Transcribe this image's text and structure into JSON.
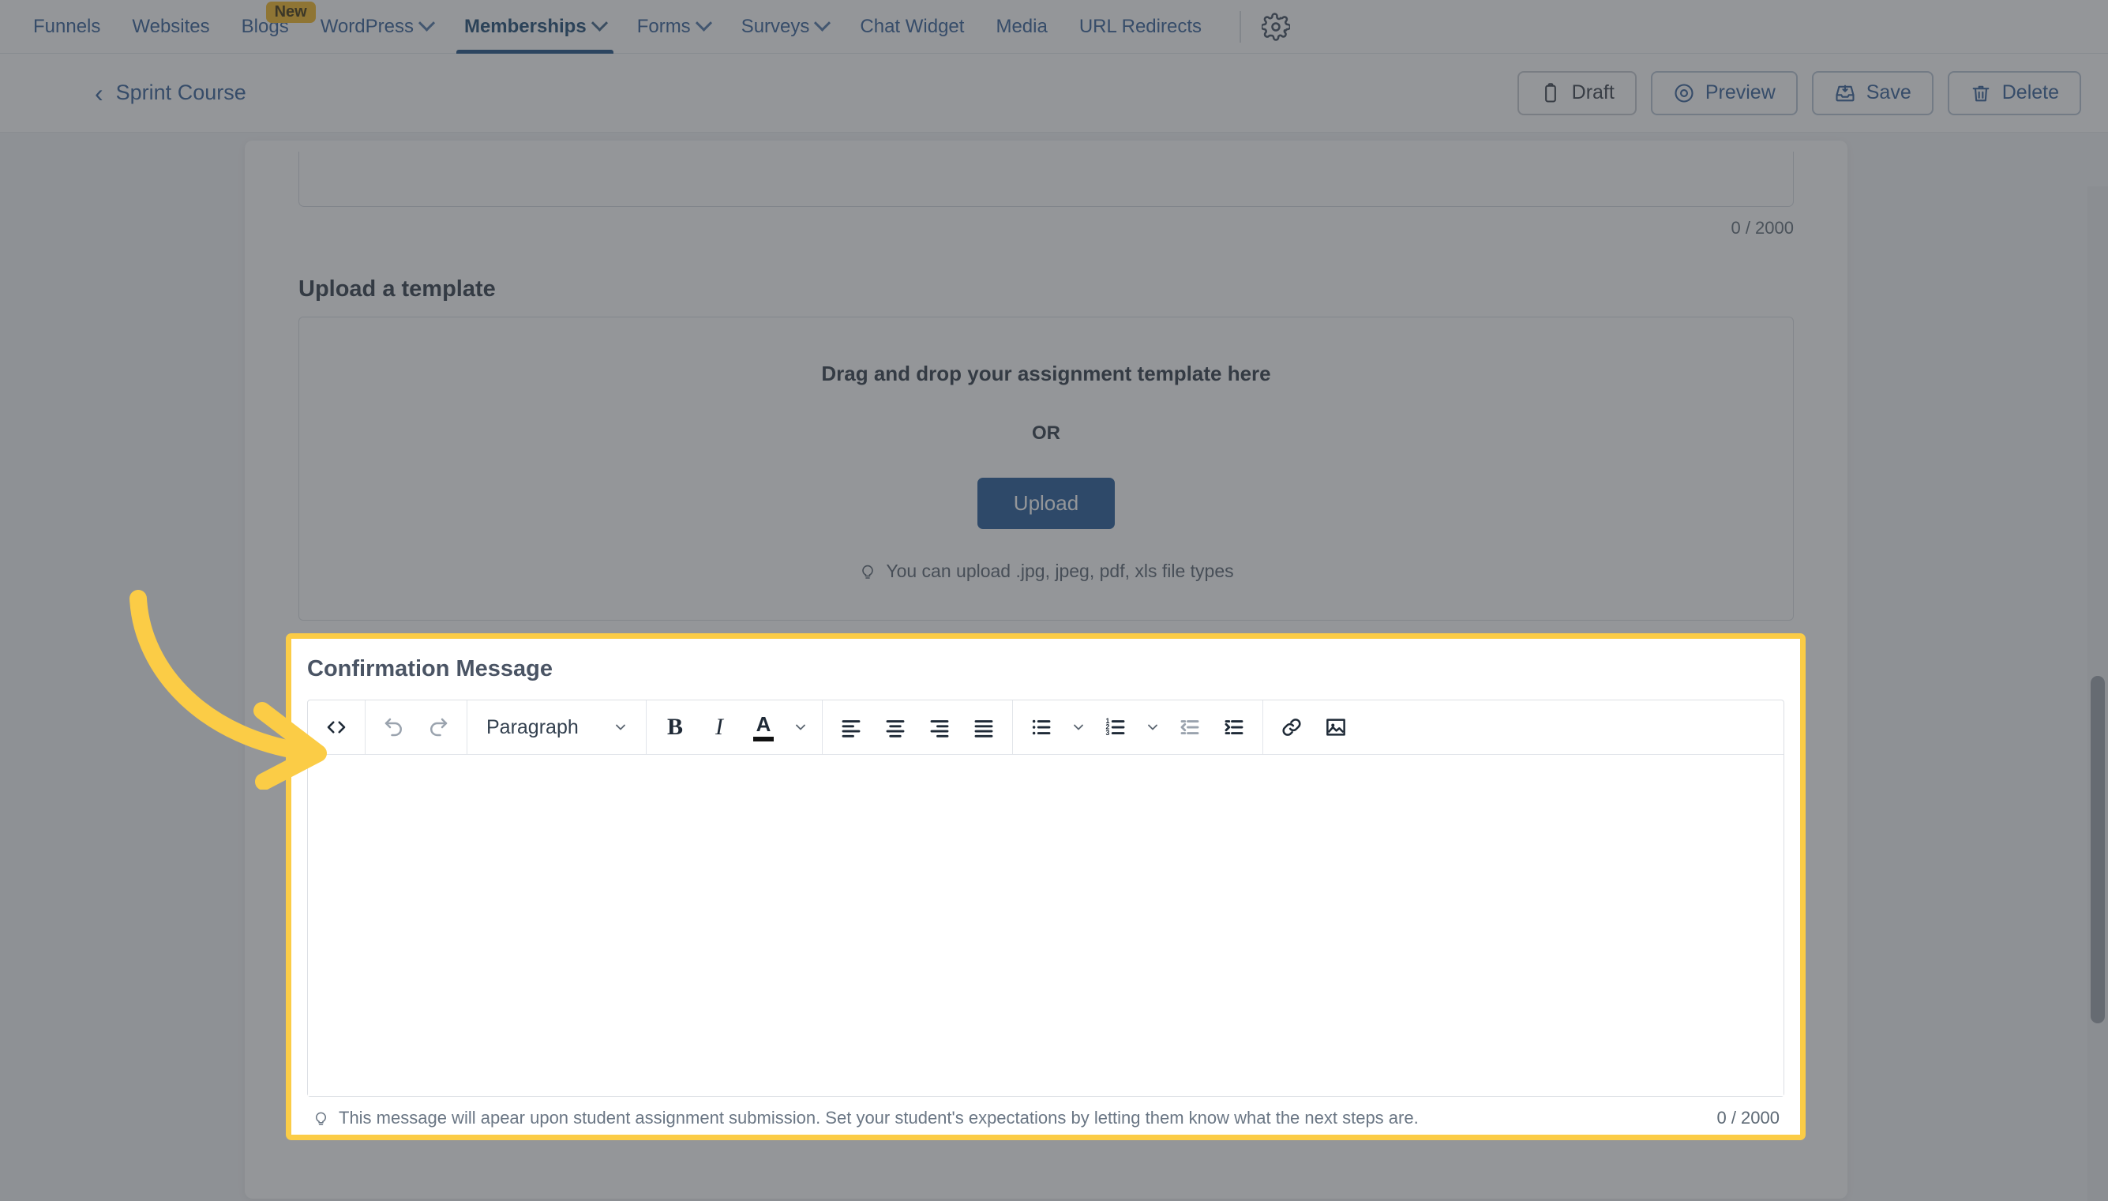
{
  "nav": {
    "items": [
      {
        "label": "Funnels",
        "caret": false,
        "active": false,
        "badge": null
      },
      {
        "label": "Websites",
        "caret": false,
        "active": false,
        "badge": null
      },
      {
        "label": "Blogs",
        "caret": false,
        "active": false,
        "badge": "New"
      },
      {
        "label": "WordPress",
        "caret": true,
        "active": false,
        "badge": null
      },
      {
        "label": "Memberships",
        "caret": true,
        "active": true,
        "badge": null
      },
      {
        "label": "Forms",
        "caret": true,
        "active": false,
        "badge": null
      },
      {
        "label": "Surveys",
        "caret": true,
        "active": false,
        "badge": null
      },
      {
        "label": "Chat Widget",
        "caret": false,
        "active": false,
        "badge": null
      },
      {
        "label": "Media",
        "caret": false,
        "active": false,
        "badge": null
      },
      {
        "label": "URL Redirects",
        "caret": false,
        "active": false,
        "badge": null
      }
    ],
    "settings_icon": "gear-icon"
  },
  "subheader": {
    "back_arrow": "‹",
    "breadcrumb": "Sprint Course",
    "buttons": [
      {
        "label": "Draft",
        "icon": "clipboard-icon",
        "style": "dark"
      },
      {
        "label": "Preview",
        "icon": "eye-icon",
        "style": "blue"
      },
      {
        "label": "Save",
        "icon": "save-inbox-icon",
        "style": "blue"
      },
      {
        "label": "Delete",
        "icon": "trash-icon",
        "style": "blue"
      }
    ]
  },
  "description_counter": "0 / 2000",
  "upload_section": {
    "title": "Upload a template",
    "drop_text": "Drag and drop your assignment template here",
    "or_text": "OR",
    "upload_button": "Upload",
    "hint": "You can upload .jpg, jpeg, pdf, xls file types",
    "hint_icon": "lightbulb-icon"
  },
  "confirmation": {
    "title": "Confirmation Message",
    "toolbar": {
      "code_view": "code-view-icon",
      "undo": "undo-icon",
      "redo": "redo-icon",
      "block_format": "Paragraph",
      "bold": "B",
      "italic": "I",
      "text_color": "A",
      "align_left": "align-left-icon",
      "align_center": "align-center-icon",
      "align_right": "align-right-icon",
      "align_justify": "align-justify-icon",
      "bullet_list": "bullet-list-icon",
      "numbered_list": "numbered-list-icon",
      "outdent": "outdent-icon",
      "indent": "indent-icon",
      "link": "link-icon",
      "image": "image-icon"
    },
    "body_value": "",
    "hint": "This message will apear upon student assignment submission. Set your student's expectations by letting them know what the next steps are.",
    "hint_icon": "lightbulb-icon",
    "counter": "0 / 2000"
  },
  "annotation": {
    "arrow": "curved-arrow-right",
    "color": "#fbcc46"
  },
  "colors": {
    "accent_blue": "#1d5494",
    "nav_blue": "#2f5b96",
    "highlight_yellow": "#fbcc46",
    "badge_yellow": "#f3b61f",
    "dim": "rgba(60,64,70,.55)"
  }
}
